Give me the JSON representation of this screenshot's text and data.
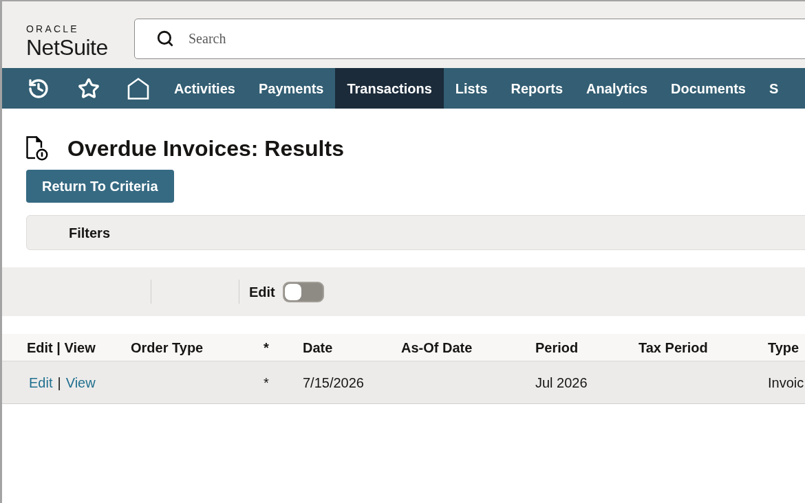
{
  "header": {
    "logo": {
      "brand": "ORACLE",
      "product": "NetSuite"
    },
    "search": {
      "placeholder": "Search"
    }
  },
  "nav": {
    "items": [
      {
        "label": "Activities",
        "selected": false
      },
      {
        "label": "Payments",
        "selected": false
      },
      {
        "label": "Transactions",
        "selected": true
      },
      {
        "label": "Lists",
        "selected": false
      },
      {
        "label": "Reports",
        "selected": false
      },
      {
        "label": "Analytics",
        "selected": false
      },
      {
        "label": "Documents",
        "selected": false
      },
      {
        "label": "S",
        "selected": false
      }
    ]
  },
  "page": {
    "title": "Overdue Invoices: Results",
    "return_button": "Return To Criteria",
    "filters": {
      "label": "Filters"
    }
  },
  "toolbar": {
    "edit_toggle": {
      "label": "Edit",
      "on": false
    }
  },
  "table": {
    "columns": [
      "Edit | View",
      "Order Type",
      "*",
      "Date",
      "As-Of Date",
      "Period",
      "Tax Period",
      "Type"
    ],
    "rows": [
      {
        "cells": [
          {
            "kind": "links",
            "links": [
              "Edit",
              "View"
            ],
            "separator": "|"
          },
          null,
          "*",
          "7/15/2026",
          null,
          "Jul 2026",
          null,
          "Invoic"
        ]
      }
    ]
  }
}
